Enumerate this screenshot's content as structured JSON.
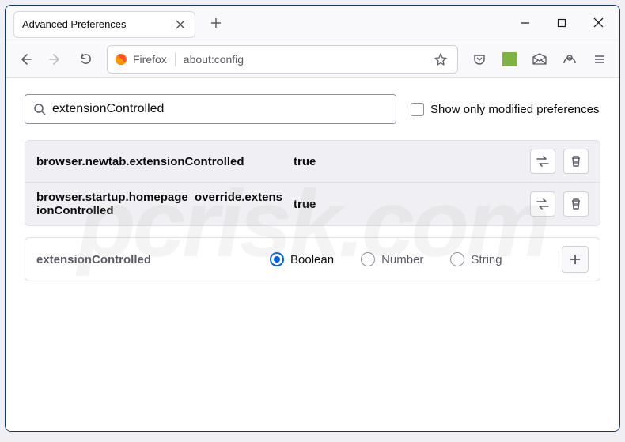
{
  "window": {
    "tab_title": "Advanced Preferences"
  },
  "urlbar": {
    "identity": "Firefox",
    "url": "about:config"
  },
  "search": {
    "value": "extensionControlled",
    "modified_label": "Show only modified preferences"
  },
  "prefs": [
    {
      "name": "browser.newtab.extensionControlled",
      "value": "true"
    },
    {
      "name": "browser.startup.homepage_override.extensionControlled",
      "value": "true"
    }
  ],
  "add": {
    "name": "extensionControlled",
    "types": {
      "boolean": "Boolean",
      "number": "Number",
      "string": "String"
    },
    "selected": "boolean"
  },
  "watermark": "pcrisk.com"
}
